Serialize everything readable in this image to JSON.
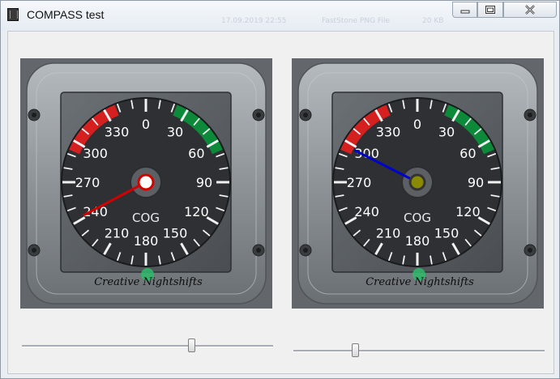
{
  "window": {
    "title": "COMPASS test",
    "icon": "film-strip-icon"
  },
  "titlebar_controls": [
    {
      "name": "minimize",
      "icon": "minimize-icon"
    },
    {
      "name": "maximize",
      "icon": "maximize-icon"
    },
    {
      "name": "close",
      "icon": "close-icon"
    }
  ],
  "background_text": [
    "",
    "17.09.2019 22:55",
    "FastStone PNG File",
    "20 KB"
  ],
  "compasses": [
    {
      "label": "COG",
      "brand": "Creative Nightshifts",
      "dial_numbers": [
        "0",
        "30",
        "60",
        "90",
        "120",
        "150",
        "180",
        "210",
        "240",
        "270",
        "300",
        "330"
      ],
      "heading_deg": 242,
      "needle_color": "#d40000",
      "hub_color": "#ffffff",
      "hub_ring_color": "#d40000"
    },
    {
      "label": "COG",
      "brand": "Creative Nightshifts",
      "dial_numbers": [
        "0",
        "30",
        "60",
        "90",
        "120",
        "150",
        "180",
        "210",
        "240",
        "270",
        "300",
        "330"
      ],
      "heading_deg": 297,
      "needle_color": "#0000cc",
      "hub_color": "#8a8a00",
      "hub_ring_color": "#333333"
    }
  ],
  "sliders": [
    {
      "name": "compass-1-slider",
      "value_fraction": 0.68
    },
    {
      "name": "compass-2-slider",
      "value_fraction": 0.24
    }
  ],
  "colors": {
    "dial_face": "#2e3033",
    "bezel": "#8e9398",
    "red_arc": "#d62020",
    "green_arc": "#0c8a3a"
  }
}
